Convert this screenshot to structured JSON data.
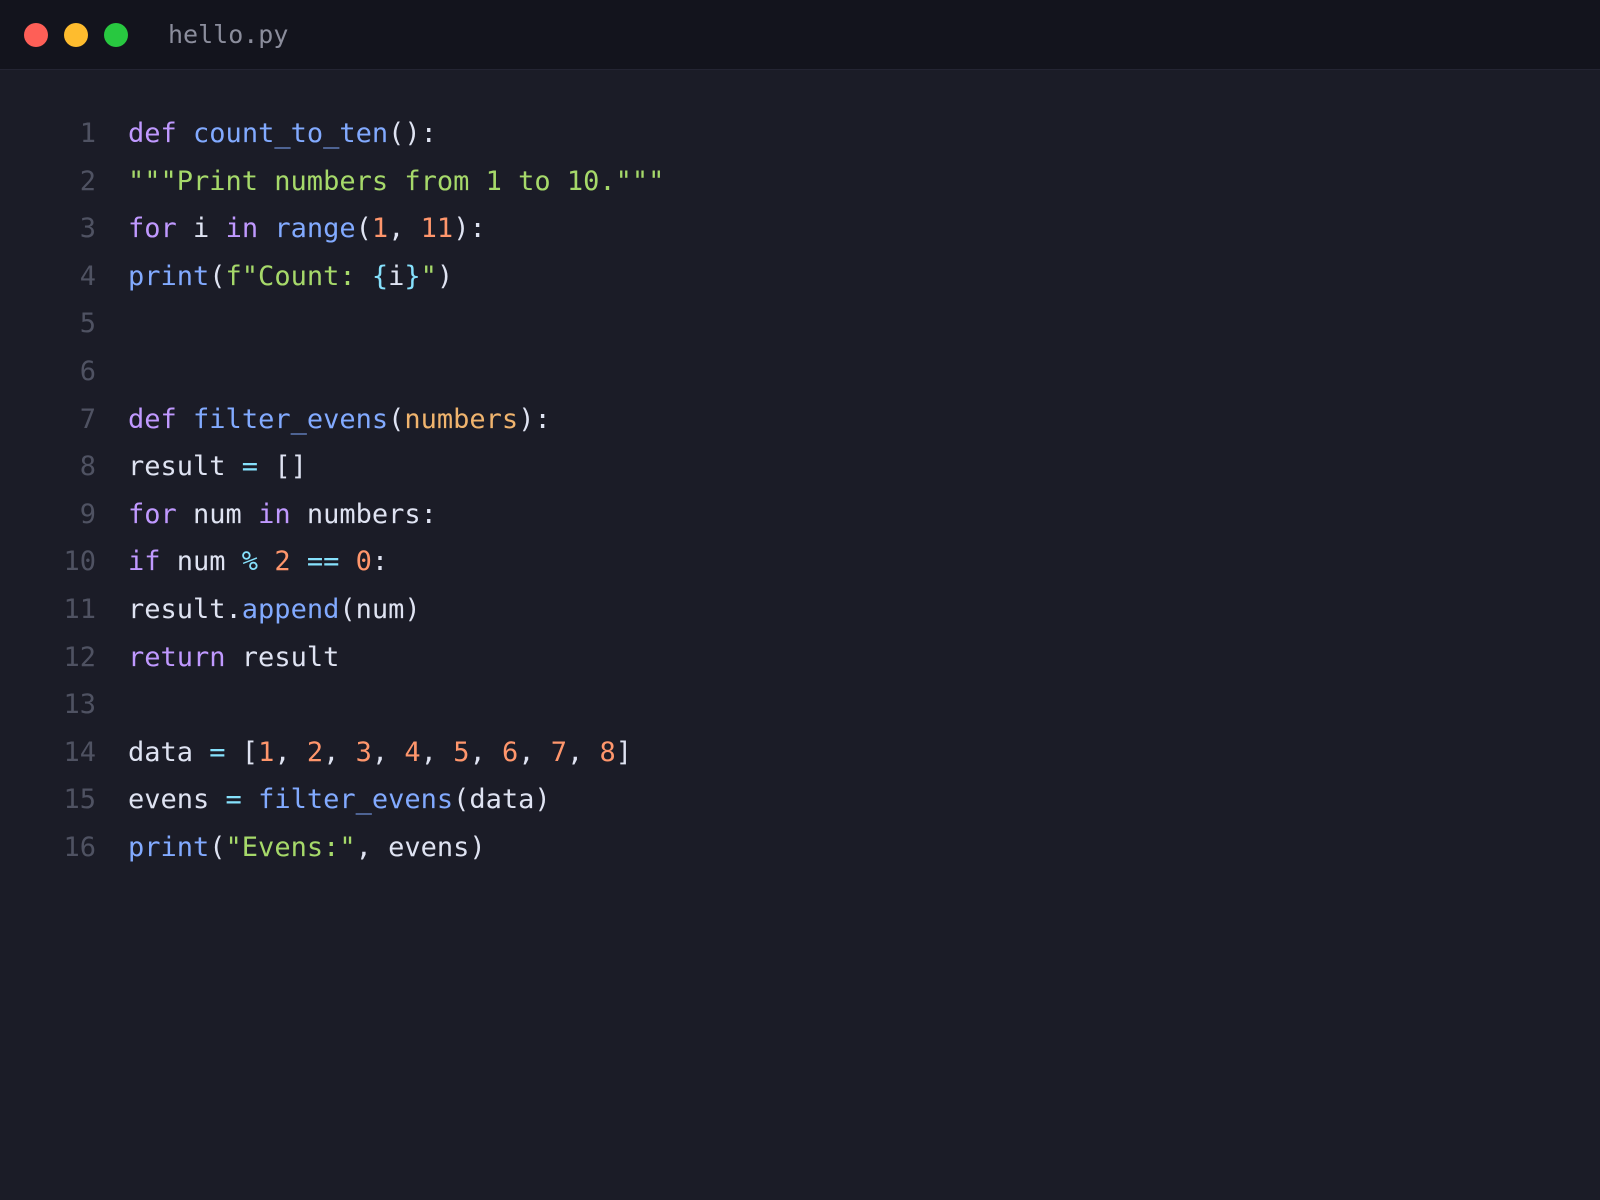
{
  "window": {
    "title": "hello.py",
    "controls": {
      "close_color": "#fe5f57",
      "minimize_color": "#febc2e",
      "maximize_color": "#28c840"
    }
  },
  "theme": {
    "background": "#1b1c27",
    "titlebar": "#13141d",
    "line_number": "#4f5262",
    "keyword": "#c099ff",
    "function": "#82aaff",
    "string": "#a6d96a",
    "number": "#ff966c",
    "param": "#f0b46e",
    "operator": "#86e1fc",
    "text": "#dfe3f2"
  },
  "editor": {
    "lines": [
      {
        "number": "1",
        "tokens": [
          {
            "t": "def",
            "k": "keyword"
          },
          {
            "t": " ",
            "k": "text"
          },
          {
            "t": "count_to_ten",
            "k": "function"
          },
          {
            "t": "():",
            "k": "text"
          }
        ]
      },
      {
        "number": "2",
        "tokens": [
          {
            "t": "\"\"\"Print numbers from 1 to 10.\"\"\"",
            "k": "string"
          }
        ]
      },
      {
        "number": "3",
        "tokens": [
          {
            "t": "for",
            "k": "keyword"
          },
          {
            "t": " i ",
            "k": "text"
          },
          {
            "t": "in",
            "k": "keyword"
          },
          {
            "t": " ",
            "k": "text"
          },
          {
            "t": "range",
            "k": "function"
          },
          {
            "t": "(",
            "k": "text"
          },
          {
            "t": "1",
            "k": "number"
          },
          {
            "t": ", ",
            "k": "text"
          },
          {
            "t": "11",
            "k": "number"
          },
          {
            "t": "):",
            "k": "text"
          }
        ]
      },
      {
        "number": "4",
        "tokens": [
          {
            "t": "print",
            "k": "function"
          },
          {
            "t": "(",
            "k": "text"
          },
          {
            "t": "f\"Count: ",
            "k": "string"
          },
          {
            "t": "{",
            "k": "operator"
          },
          {
            "t": "i",
            "k": "text"
          },
          {
            "t": "}",
            "k": "operator"
          },
          {
            "t": "\"",
            "k": "string"
          },
          {
            "t": ")",
            "k": "text"
          }
        ]
      },
      {
        "number": "5",
        "tokens": []
      },
      {
        "number": "6",
        "tokens": []
      },
      {
        "number": "7",
        "tokens": [
          {
            "t": "def",
            "k": "keyword"
          },
          {
            "t": " ",
            "k": "text"
          },
          {
            "t": "filter_evens",
            "k": "function"
          },
          {
            "t": "(",
            "k": "text"
          },
          {
            "t": "numbers",
            "k": "param"
          },
          {
            "t": "):",
            "k": "text"
          }
        ]
      },
      {
        "number": "8",
        "tokens": [
          {
            "t": "result ",
            "k": "text"
          },
          {
            "t": "=",
            "k": "operator"
          },
          {
            "t": " []",
            "k": "text"
          }
        ]
      },
      {
        "number": "9",
        "tokens": [
          {
            "t": "for",
            "k": "keyword"
          },
          {
            "t": " num ",
            "k": "text"
          },
          {
            "t": "in",
            "k": "keyword"
          },
          {
            "t": " numbers:",
            "k": "text"
          }
        ]
      },
      {
        "number": "10",
        "tokens": [
          {
            "t": "if",
            "k": "keyword"
          },
          {
            "t": " num ",
            "k": "text"
          },
          {
            "t": "%",
            "k": "operator"
          },
          {
            "t": " ",
            "k": "text"
          },
          {
            "t": "2",
            "k": "number"
          },
          {
            "t": " ",
            "k": "text"
          },
          {
            "t": "==",
            "k": "operator"
          },
          {
            "t": " ",
            "k": "text"
          },
          {
            "t": "0",
            "k": "number"
          },
          {
            "t": ":",
            "k": "text"
          }
        ]
      },
      {
        "number": "11",
        "tokens": [
          {
            "t": "result.",
            "k": "text"
          },
          {
            "t": "append",
            "k": "function"
          },
          {
            "t": "(num)",
            "k": "text"
          }
        ]
      },
      {
        "number": "12",
        "tokens": [
          {
            "t": "return",
            "k": "keyword"
          },
          {
            "t": " result",
            "k": "text"
          }
        ]
      },
      {
        "number": "13",
        "tokens": []
      },
      {
        "number": "14",
        "tokens": [
          {
            "t": "data ",
            "k": "text"
          },
          {
            "t": "=",
            "k": "operator"
          },
          {
            "t": " [",
            "k": "text"
          },
          {
            "t": "1",
            "k": "number"
          },
          {
            "t": ", ",
            "k": "text"
          },
          {
            "t": "2",
            "k": "number"
          },
          {
            "t": ", ",
            "k": "text"
          },
          {
            "t": "3",
            "k": "number"
          },
          {
            "t": ", ",
            "k": "text"
          },
          {
            "t": "4",
            "k": "number"
          },
          {
            "t": ", ",
            "k": "text"
          },
          {
            "t": "5",
            "k": "number"
          },
          {
            "t": ", ",
            "k": "text"
          },
          {
            "t": "6",
            "k": "number"
          },
          {
            "t": ", ",
            "k": "text"
          },
          {
            "t": "7",
            "k": "number"
          },
          {
            "t": ", ",
            "k": "text"
          },
          {
            "t": "8",
            "k": "number"
          },
          {
            "t": "]",
            "k": "text"
          }
        ]
      },
      {
        "number": "15",
        "tokens": [
          {
            "t": "evens ",
            "k": "text"
          },
          {
            "t": "=",
            "k": "operator"
          },
          {
            "t": " ",
            "k": "text"
          },
          {
            "t": "filter_evens",
            "k": "function"
          },
          {
            "t": "(data)",
            "k": "text"
          }
        ]
      },
      {
        "number": "16",
        "tokens": [
          {
            "t": "print",
            "k": "function"
          },
          {
            "t": "(",
            "k": "text"
          },
          {
            "t": "\"Evens:\"",
            "k": "string"
          },
          {
            "t": ", evens)",
            "k": "text"
          }
        ]
      }
    ]
  }
}
